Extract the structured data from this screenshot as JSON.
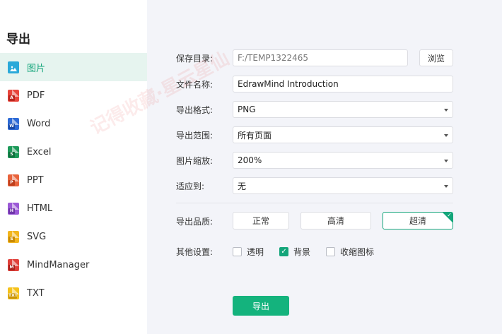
{
  "sidebar": {
    "title": "导出",
    "items": [
      {
        "label": "图片",
        "icon": "image-icon",
        "color": "#2aa9d9",
        "active": true
      },
      {
        "label": "PDF",
        "icon": "pdf-file-icon",
        "color": "#e8463c",
        "active": false
      },
      {
        "label": "Word",
        "icon": "word-file-icon",
        "color": "#2e6bd6",
        "active": false
      },
      {
        "label": "Excel",
        "icon": "excel-file-icon",
        "color": "#1d9a5a",
        "active": false
      },
      {
        "label": "PPT",
        "icon": "ppt-file-icon",
        "color": "#e8633c",
        "active": false
      },
      {
        "label": "HTML",
        "icon": "html-file-icon",
        "color": "#9b59d6",
        "active": false
      },
      {
        "label": "SVG",
        "icon": "svg-file-icon",
        "color": "#f2b51e",
        "active": false
      },
      {
        "label": "MindManager",
        "icon": "mindmanager-file-icon",
        "color": "#e0403a",
        "active": false
      },
      {
        "label": "TXT",
        "icon": "txt-file-icon",
        "color": "#f5c21b",
        "active": false
      }
    ]
  },
  "form": {
    "save_dir_label": "保存目录:",
    "save_dir_value": "F:/TEMP1322465",
    "browse_label": "浏览",
    "filename_label": "文件名称:",
    "filename_value": "EdrawMind Introduction",
    "format_label": "导出格式:",
    "format_value": "PNG",
    "range_label": "导出范围:",
    "range_value": "所有页面",
    "scale_label": "图片缩放:",
    "scale_value": "200%",
    "fit_label": "适应到:",
    "fit_value": "无",
    "quality_label": "导出品质:",
    "quality_options": [
      "正常",
      "高清",
      "超清"
    ],
    "quality_selected": "超清",
    "other_label": "其他设置:",
    "other_options": [
      {
        "label": "透明",
        "checked": false
      },
      {
        "label": "背景",
        "checked": true
      },
      {
        "label": "收缩图标",
        "checked": false
      }
    ],
    "export_label": "导出"
  },
  "watermark": "记得收藏·星云星仙",
  "colors": {
    "accent": "#13a57a",
    "export_button": "#14b37d",
    "active_bg": "#e6f4ef",
    "content_bg": "#f3f4f9"
  }
}
